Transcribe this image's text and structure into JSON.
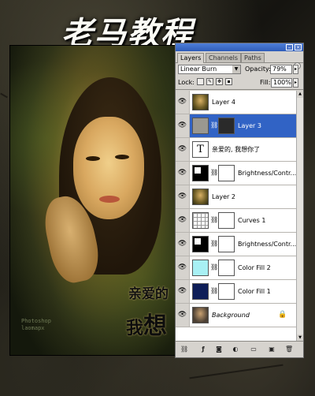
{
  "title": "老马教程",
  "artwork": {
    "line1": "亲爱的",
    "line2_small": "我",
    "line2_big": "想",
    "credit_line1": "Photoshop",
    "credit_line2": "laomapx"
  },
  "panel": {
    "tabs": [
      "Layers",
      "Channels",
      "Paths"
    ],
    "active_tab": "Layers",
    "blend_mode": "Linear Burn",
    "opacity_label": "Opacity:",
    "opacity_value": "79%",
    "lock_label": "Lock:",
    "fill_label": "Fill:",
    "fill_value": "100%",
    "window_buttons": [
      "minimize",
      "close"
    ],
    "layers": [
      {
        "name": "Layer 4",
        "thumb": "portrait",
        "mask": false,
        "selected": false
      },
      {
        "name": "Layer 3",
        "thumb": "layer3",
        "mask": true,
        "selected": true
      },
      {
        "name": "亲爱的, 我想你了",
        "thumb": "type",
        "mask": false,
        "selected": false
      },
      {
        "name": "Brightness/Contr...",
        "thumb": "adjust",
        "mask": true,
        "selected": false
      },
      {
        "name": "Layer 2",
        "thumb": "portrait",
        "mask": false,
        "selected": false
      },
      {
        "name": "Curves 1",
        "thumb": "curves",
        "mask": true,
        "selected": false
      },
      {
        "name": "Brightness/Contr...",
        "thumb": "adjust",
        "mask": true,
        "selected": false
      },
      {
        "name": "Color Fill 2",
        "thumb": "cyan",
        "mask": true,
        "selected": false
      },
      {
        "name": "Color Fill 1",
        "thumb": "navy",
        "mask": true,
        "selected": false
      },
      {
        "name": "Background",
        "thumb": "bg",
        "mask": false,
        "selected": false,
        "locked": true,
        "italic": true
      }
    ],
    "bottom_icons": [
      "link-icon",
      "layer-style-icon",
      "add-mask-icon",
      "adjustment-layer-icon",
      "new-group-icon",
      "new-layer-icon",
      "delete-layer-icon"
    ]
  }
}
